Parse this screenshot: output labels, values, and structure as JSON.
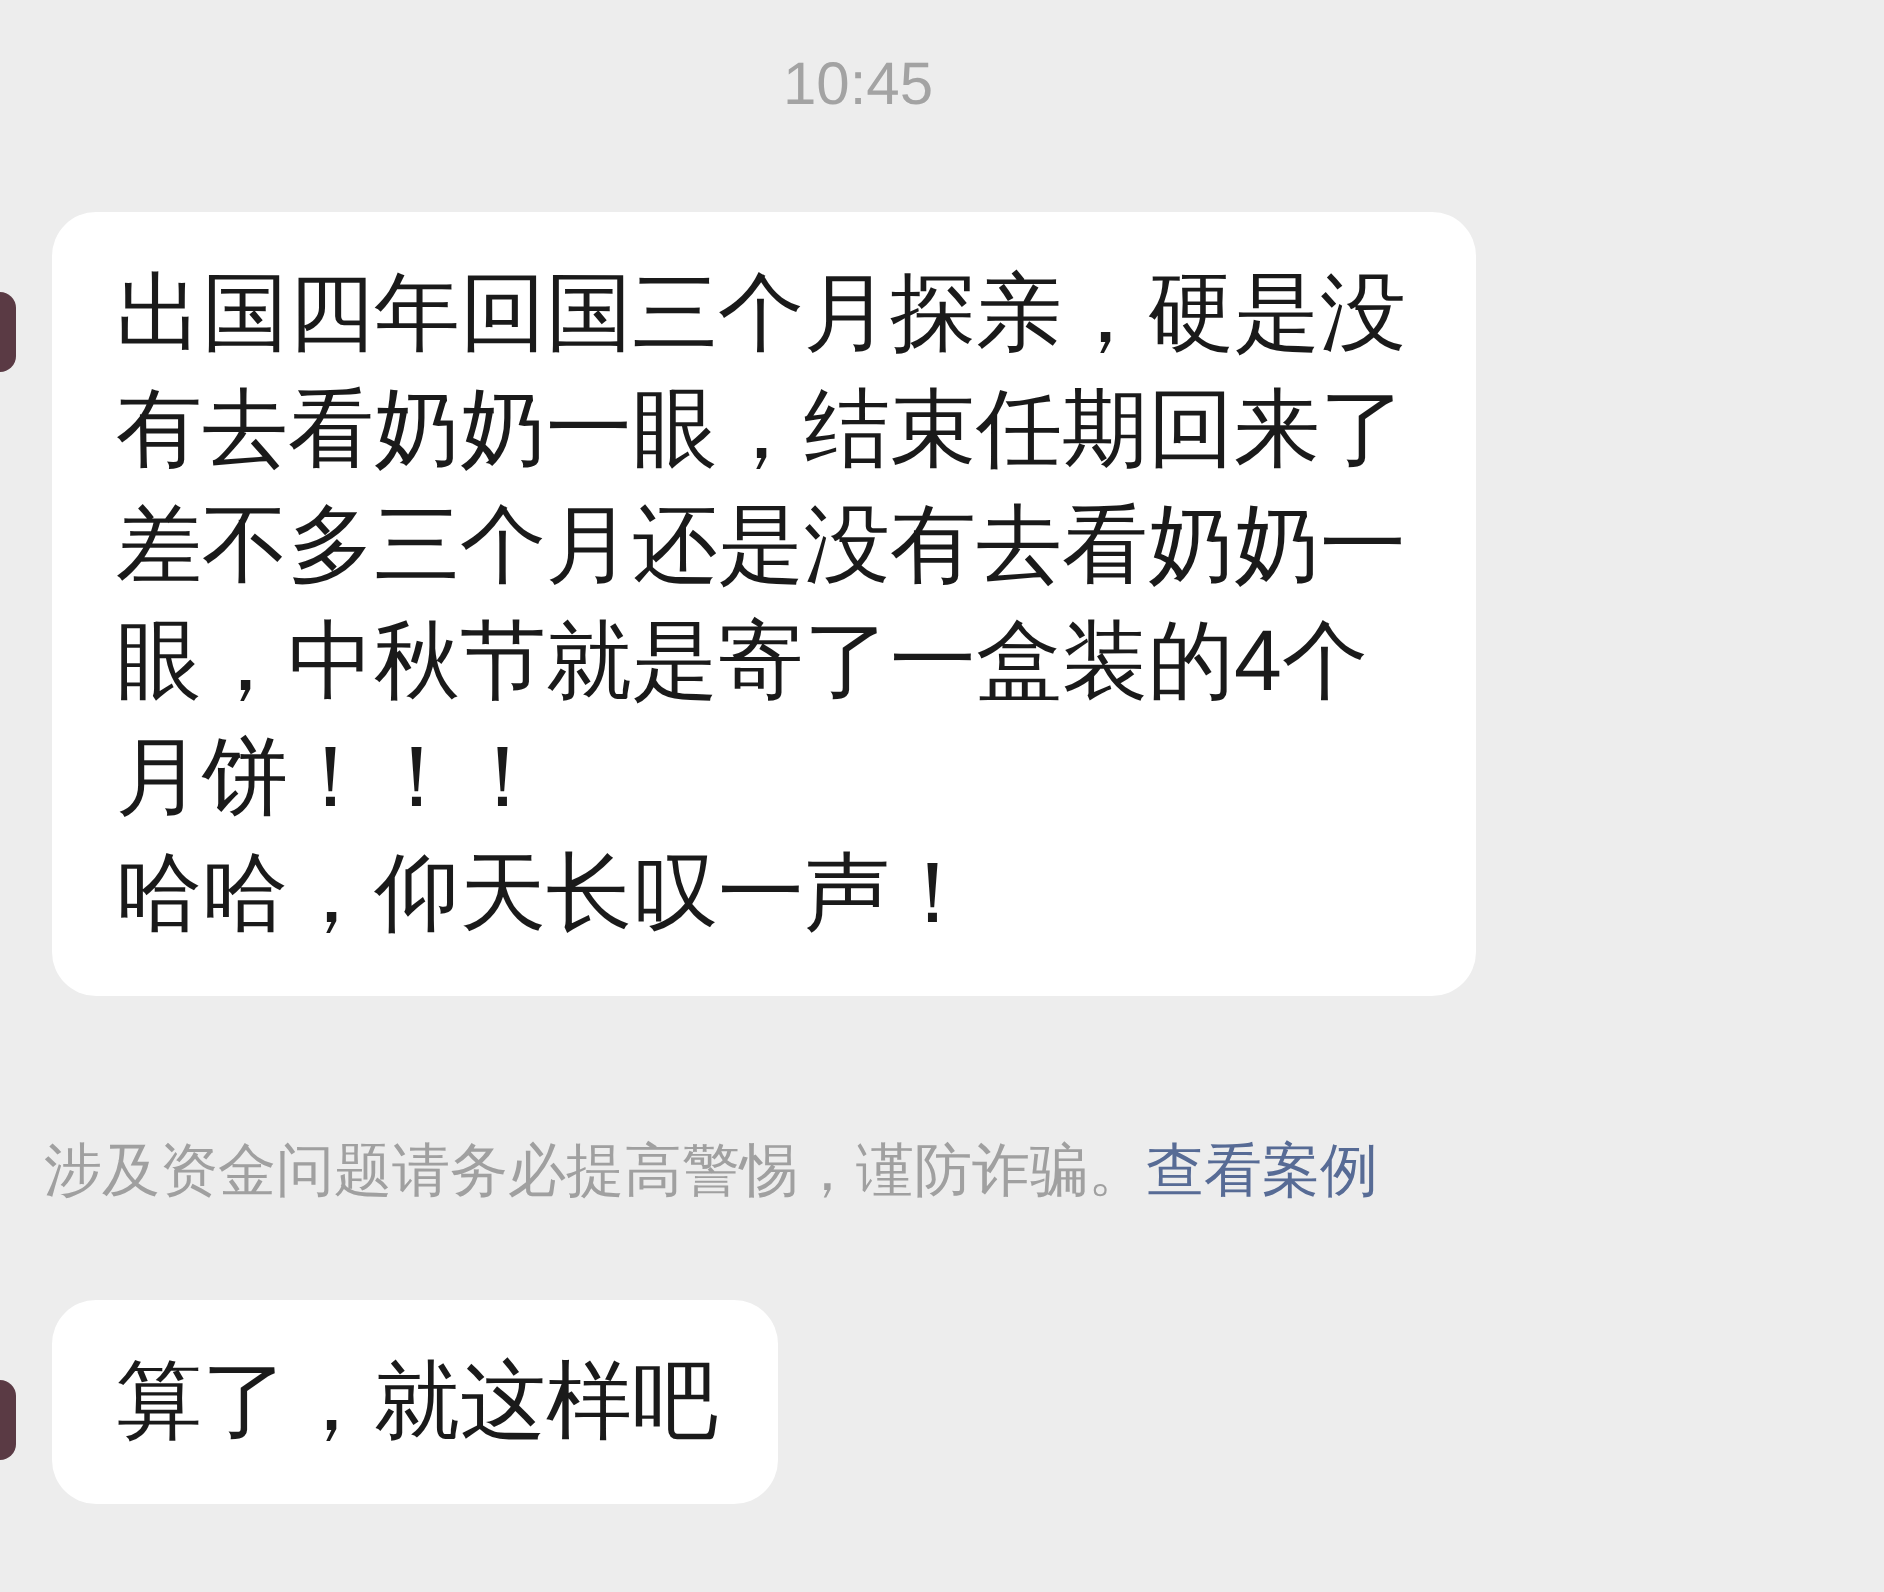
{
  "timestamp": "10:45",
  "messages": [
    {
      "kind": "received",
      "paragraphs": [
        "出国四年回国三个月探亲，硬是没有去看奶奶一眼，结束任期回来了差不多三个月还是没有去看奶奶一眼，中秋节就是寄了一盒装的4个月饼！！！",
        "哈哈，仰天长叹一声！"
      ]
    },
    {
      "kind": "notice",
      "text": "涉及资金问题请务必提高警惕，谨防诈骗。",
      "link": "查看案例"
    },
    {
      "kind": "received",
      "paragraphs": [
        "算了，就这样吧"
      ]
    }
  ]
}
